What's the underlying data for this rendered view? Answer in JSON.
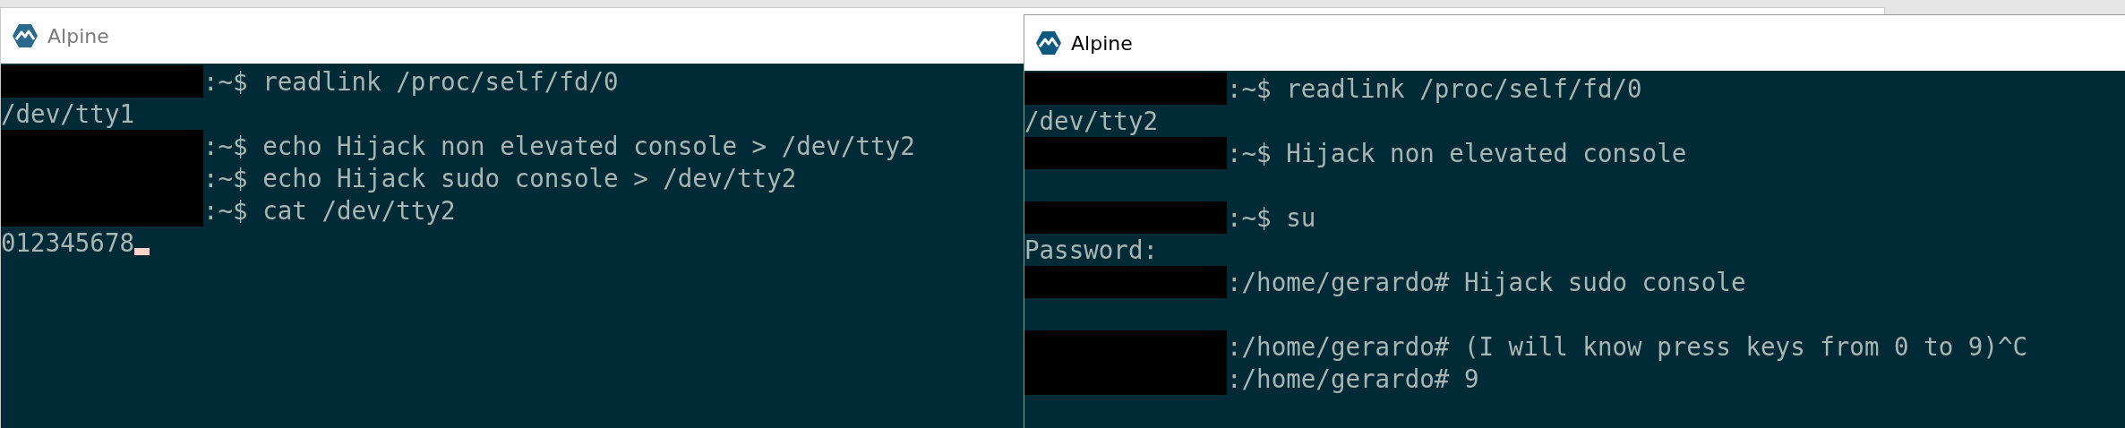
{
  "windows": [
    {
      "title": "Alpine",
      "active": false,
      "lines": [
        {
          "kind": "prompt",
          "redacted": true,
          "text": ":~$ readlink /proc/self/fd/0"
        },
        {
          "kind": "output",
          "text": "/dev/tty1"
        },
        {
          "kind": "prompt",
          "redacted": true,
          "text": ":~$ echo Hijack non elevated console > /dev/tty2"
        },
        {
          "kind": "prompt",
          "redacted": true,
          "text": ":~$ echo Hijack sudo console > /dev/tty2"
        },
        {
          "kind": "prompt",
          "redacted": true,
          "text": ":~$ cat /dev/tty2"
        },
        {
          "kind": "output",
          "text": "012345678",
          "cursor": true
        }
      ]
    },
    {
      "title": "Alpine",
      "active": true,
      "lines": [
        {
          "kind": "prompt",
          "redacted": true,
          "text": ":~$ readlink /proc/self/fd/0"
        },
        {
          "kind": "output",
          "text": "/dev/tty2"
        },
        {
          "kind": "prompt",
          "redacted": true,
          "text": ":~$ Hijack non elevated console"
        },
        {
          "kind": "blank"
        },
        {
          "kind": "prompt",
          "redacted": true,
          "text": ":~$ su"
        },
        {
          "kind": "output",
          "text": "Password:"
        },
        {
          "kind": "prompt",
          "redacted": true,
          "text": ":/home/gerardo# Hijack sudo console"
        },
        {
          "kind": "blank"
        },
        {
          "kind": "prompt",
          "redacted": true,
          "text": ":/home/gerardo# (I will know press keys from 0 to 9)^C"
        },
        {
          "kind": "prompt",
          "redacted": true,
          "text": ":/home/gerardo# 9"
        }
      ]
    }
  ]
}
